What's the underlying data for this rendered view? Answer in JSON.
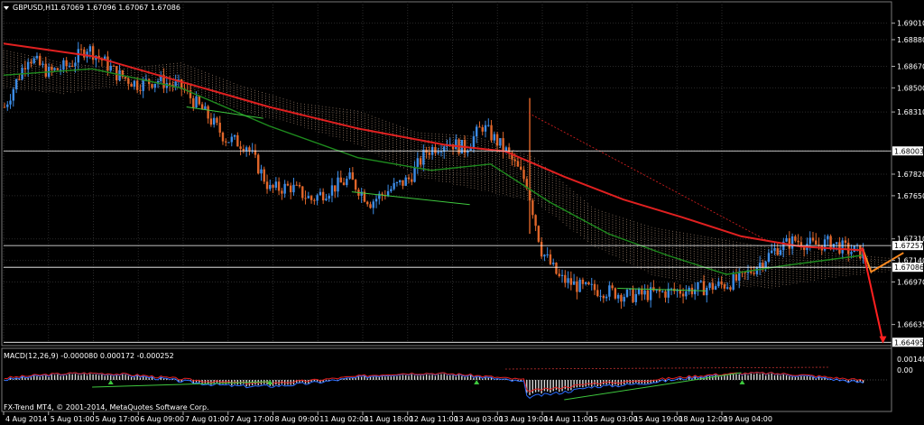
{
  "header": {
    "symbol": "GBPUSD,H1",
    "ohlc": "1.67069 1.67096 1.67067 1.67086"
  },
  "macd": {
    "title": "MACD(12,26,9) -0.000080 0.000172 -0.000252",
    "ticks": [
      "0.00140",
      "0.00"
    ]
  },
  "footer": "FX-Trend MT4, © 2001-2014, MetaQuotes Software Corp.",
  "colors": {
    "background": "#000000",
    "grid": "#2a2a2a",
    "candle_up": "#3c8ce6",
    "candle_down": "#e0662a",
    "ma_red": "#e02020",
    "ma_green": "#1e8c1e",
    "cloud": "#c9a78c",
    "trendline": "#3ec83e",
    "forecast_orange": "#ff8a1e",
    "forecast_red": "#ff2020",
    "hline": "#ffffff"
  },
  "chart_data": {
    "type": "candlestick",
    "timeframe": "H1",
    "price_ticks": [
      "1.69010",
      "1.68880",
      "1.68670",
      "1.68500",
      "1.68310",
      "1.68003",
      "1.67820",
      "1.67650",
      "1.67310",
      "1.67140",
      "1.66970",
      "1.66635"
    ],
    "ylim": [
      1.6649,
      1.6915
    ],
    "x_ticks": [
      "4 Aug 2014",
      "5 Aug 01:00",
      "5 Aug 17:00",
      "6 Aug 09:00",
      "7 Aug 01:00",
      "7 Aug 17:00",
      "8 Aug 09:00",
      "11 Aug 02:00",
      "11 Aug 18:00",
      "12 Aug 11:00",
      "13 Aug 03:00",
      "13 Aug 19:00",
      "14 Aug 11:00",
      "15 Aug 03:00",
      "15 Aug 19:00",
      "18 Aug 12:00",
      "19 Aug 04:00"
    ],
    "horizontal_levels": [
      {
        "label": "1.68003",
        "price": 1.68003
      },
      {
        "label": "1.67257",
        "price": 1.67257
      },
      {
        "label": "1.67086",
        "price": 1.67086
      },
      {
        "label": "1.66495",
        "price": 1.66495
      }
    ],
    "close_path": [
      [
        0,
        1.6835
      ],
      [
        8,
        1.6875
      ],
      [
        15,
        1.6862
      ],
      [
        22,
        1.6868
      ],
      [
        28,
        1.6882
      ],
      [
        34,
        1.687
      ],
      [
        38,
        1.6861
      ],
      [
        45,
        1.6853
      ],
      [
        52,
        1.6856
      ],
      [
        60,
        1.685
      ],
      [
        68,
        1.683
      ],
      [
        75,
        1.681
      ],
      [
        82,
        1.6805
      ],
      [
        90,
        1.677
      ],
      [
        97,
        1.6772
      ],
      [
        104,
        1.6762
      ],
      [
        110,
        1.677
      ],
      [
        117,
        1.6778
      ],
      [
        124,
        1.676
      ],
      [
        130,
        1.6769
      ],
      [
        137,
        1.6778
      ],
      [
        143,
        1.68
      ],
      [
        150,
        1.6808
      ],
      [
        156,
        1.6802
      ],
      [
        162,
        1.682
      ],
      [
        170,
        1.68
      ],
      [
        177,
        1.6775
      ],
      [
        182,
        1.6722
      ],
      [
        188,
        1.67
      ],
      [
        196,
        1.6692
      ],
      [
        204,
        1.669
      ],
      [
        212,
        1.6686
      ],
      [
        220,
        1.6688
      ],
      [
        228,
        1.669
      ],
      [
        236,
        1.6692
      ],
      [
        244,
        1.6695
      ],
      [
        250,
        1.67
      ],
      [
        256,
        1.6712
      ],
      [
        262,
        1.6724
      ],
      [
        268,
        1.673
      ],
      [
        274,
        1.6726
      ],
      [
        280,
        1.6728
      ],
      [
        286,
        1.6722
      ],
      [
        291,
        1.672
      ]
    ],
    "ma_red": [
      [
        0,
        1.6885
      ],
      [
        30,
        1.6875
      ],
      [
        60,
        1.6855
      ],
      [
        90,
        1.6835
      ],
      [
        120,
        1.6818
      ],
      [
        150,
        1.6805
      ],
      [
        170,
        1.68
      ],
      [
        190,
        1.678
      ],
      [
        210,
        1.6762
      ],
      [
        230,
        1.6748
      ],
      [
        250,
        1.6733
      ],
      [
        270,
        1.6725
      ],
      [
        291,
        1.6722
      ]
    ],
    "ma_green": [
      [
        0,
        1.686
      ],
      [
        30,
        1.6865
      ],
      [
        60,
        1.685
      ],
      [
        90,
        1.682
      ],
      [
        120,
        1.6795
      ],
      [
        145,
        1.6785
      ],
      [
        165,
        1.679
      ],
      [
        185,
        1.676
      ],
      [
        205,
        1.6735
      ],
      [
        225,
        1.6718
      ],
      [
        245,
        1.6703
      ],
      [
        265,
        1.671
      ],
      [
        291,
        1.6718
      ]
    ],
    "cloud_top": [
      [
        0,
        1.688
      ],
      [
        20,
        1.687
      ],
      [
        40,
        1.6865
      ],
      [
        60,
        1.687
      ],
      [
        80,
        1.6852
      ],
      [
        100,
        1.6838
      ],
      [
        120,
        1.6832
      ],
      [
        140,
        1.6815
      ],
      [
        160,
        1.6812
      ],
      [
        180,
        1.6795
      ],
      [
        200,
        1.6755
      ],
      [
        220,
        1.674
      ],
      [
        240,
        1.6732
      ],
      [
        260,
        1.6724
      ],
      [
        280,
        1.672
      ],
      [
        300,
        1.6716
      ]
    ],
    "cloud_bottom": [
      [
        0,
        1.685
      ],
      [
        20,
        1.6845
      ],
      [
        40,
        1.6852
      ],
      [
        60,
        1.6848
      ],
      [
        80,
        1.6832
      ],
      [
        100,
        1.682
      ],
      [
        120,
        1.6805
      ],
      [
        140,
        1.678
      ],
      [
        160,
        1.677
      ],
      [
        180,
        1.676
      ],
      [
        200,
        1.6725
      ],
      [
        220,
        1.6702
      ],
      [
        240,
        1.6695
      ],
      [
        260,
        1.6692
      ],
      [
        280,
        1.67
      ],
      [
        300,
        1.6705
      ]
    ],
    "trendlines": [
      {
        "from": [
          62,
          1.6835
        ],
        "to": [
          88,
          1.6826
        ]
      },
      {
        "from": [
          118,
          1.6768
        ],
        "to": [
          158,
          1.6758
        ]
      },
      {
        "from": [
          208,
          1.6692
        ],
        "to": [
          238,
          1.669
        ]
      }
    ],
    "forecast_orange": [
      [
        291,
        1.6724
      ],
      [
        294,
        1.6705
      ],
      [
        305,
        1.672
      ]
    ],
    "forecast_red": [
      [
        291,
        1.6724
      ],
      [
        298,
        1.665
      ]
    ],
    "macd_hist_span": [
      0,
      291
    ],
    "macd_arrows_at": [
      36,
      90,
      160,
      250
    ]
  }
}
